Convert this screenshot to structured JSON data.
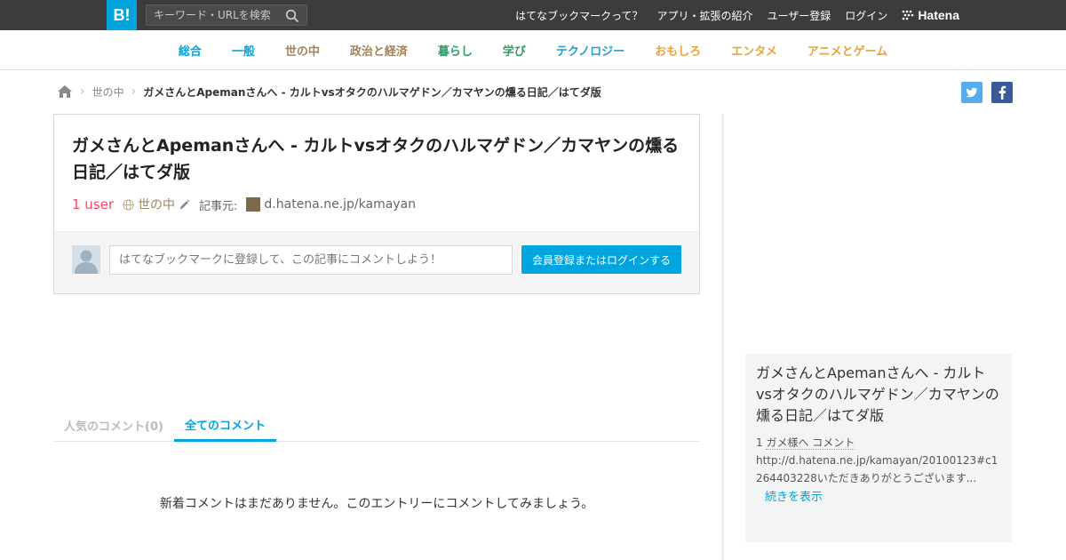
{
  "header": {
    "logo": "B!",
    "search_placeholder": "キーワード・URLを検索",
    "nav": [
      "はてなブックマークって？",
      "アプリ・拡張の紹介",
      "ユーザー登録",
      "ログイン"
    ],
    "brand": "Hatena"
  },
  "categories": [
    {
      "label": "総合",
      "color": "#00a4de"
    },
    {
      "label": "一般",
      "color": "#00a4de"
    },
    {
      "label": "世の中",
      "color": "#a0845c"
    },
    {
      "label": "政治と経済",
      "color": "#a0845c"
    },
    {
      "label": "暮らし",
      "color": "#2f9c6a"
    },
    {
      "label": "学び",
      "color": "#2f9c6a"
    },
    {
      "label": "テクノロジー",
      "color": "#2a9bd0"
    },
    {
      "label": "おもしろ",
      "color": "#e8a33d"
    },
    {
      "label": "エンタメ",
      "color": "#e8a33d"
    },
    {
      "label": "アニメとゲーム",
      "color": "#e8a33d"
    }
  ],
  "breadcrumb": {
    "category": "世の中",
    "current": "ガメさんとApemanさんへ - カルトvsオタクのハルマゲドン／カマヤンの燻る日記／はてダ版"
  },
  "entry": {
    "title": "ガメさんとApemanさんへ - カルトvsオタクのハルマゲドン／カマヤンの燻る日記／はてダ版",
    "users": "1 user",
    "category": "世の中",
    "source_label": "記事元:",
    "source": "d.hatena.ne.jp/kamayan",
    "comment_placeholder": "はてなブックマークに登録して、この記事にコメントしよう！",
    "login_button": "会員登録またはログインする"
  },
  "tabs": [
    "人気のコメント(0)",
    "全てのコメント"
  ],
  "empty_message": "新着コメントはまだありません。このエントリーにコメントしてみましょう。",
  "sidebar": {
    "title": "ガメさんとApemanさんへ - カルトvsオタクのハルマゲドン／カマヤンの燻る日記／はてダ版",
    "comment_count": "1",
    "comment_user": "ガメ様へ コメント",
    "comment_text": "http://d.hatena.ne.jp/kamayan/20100123#c1264403228いただきありがとうございます...",
    "more": "続きを表示"
  }
}
